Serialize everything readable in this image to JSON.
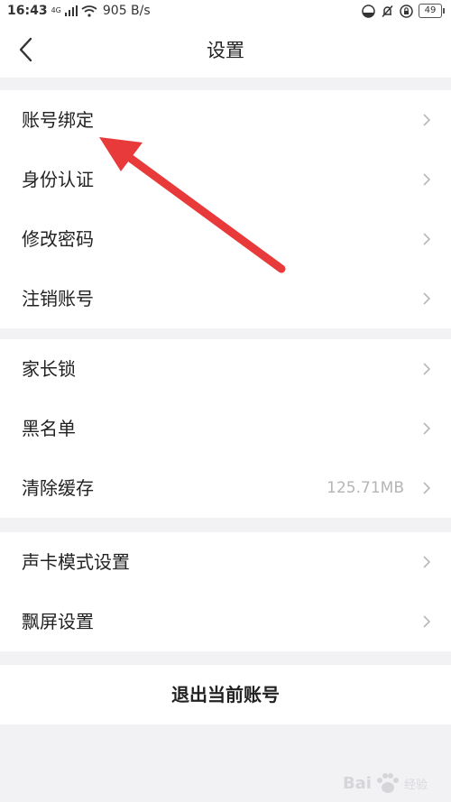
{
  "status_bar": {
    "time": "16:43",
    "network": "4G",
    "speed": "905 B/s",
    "battery": "49"
  },
  "nav": {
    "title": "设置"
  },
  "groups": [
    {
      "items": [
        {
          "label": "账号绑定"
        },
        {
          "label": "身份认证"
        },
        {
          "label": "修改密码"
        },
        {
          "label": "注销账号"
        }
      ]
    },
    {
      "items": [
        {
          "label": "家长锁"
        },
        {
          "label": "黑名单"
        },
        {
          "label": "清除缓存",
          "value": "125.71MB"
        }
      ]
    },
    {
      "items": [
        {
          "label": "声卡模式设置"
        },
        {
          "label": "飘屏设置"
        }
      ]
    }
  ],
  "logout_label": "退出当前账号",
  "watermark": {
    "brand": "Bai",
    "suffix": "经验"
  },
  "colors": {
    "background": "#f2f2f5",
    "annotation_arrow": "#e8393b"
  }
}
